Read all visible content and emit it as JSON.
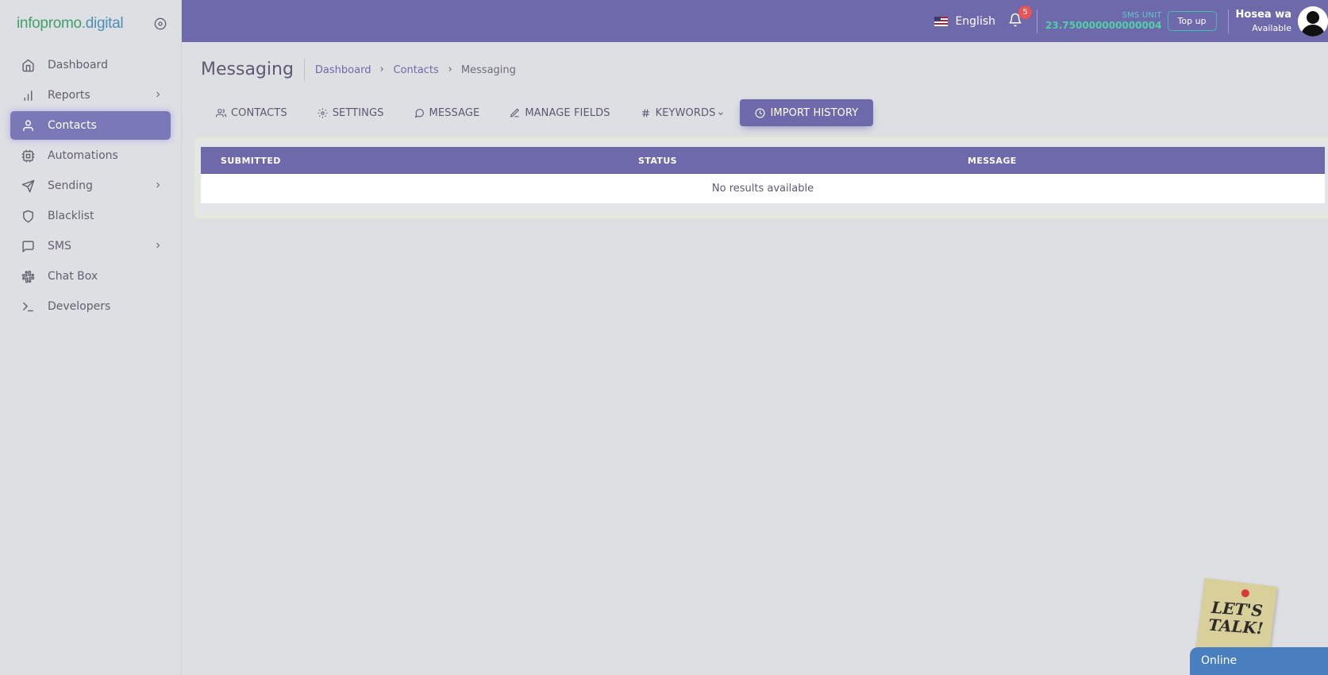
{
  "brand": {
    "logo_part1": "infopromo",
    "logo_part2": ".digital"
  },
  "sidebar": {
    "items": [
      {
        "label": "Dashboard",
        "icon": "home-icon",
        "has_chevron": false
      },
      {
        "label": "Reports",
        "icon": "bar-chart-icon",
        "has_chevron": true
      },
      {
        "label": "Contacts",
        "icon": "user-icon",
        "has_chevron": false,
        "active": true
      },
      {
        "label": "Automations",
        "icon": "cpu-icon",
        "has_chevron": false
      },
      {
        "label": "Sending",
        "icon": "send-icon",
        "has_chevron": true
      },
      {
        "label": "Blacklist",
        "icon": "shield-icon",
        "has_chevron": false
      },
      {
        "label": "SMS",
        "icon": "message-square-icon",
        "has_chevron": true
      },
      {
        "label": "Chat Box",
        "icon": "slack-icon",
        "has_chevron": false
      },
      {
        "label": "Developers",
        "icon": "terminal-icon",
        "has_chevron": false
      }
    ]
  },
  "topbar": {
    "language": "English",
    "notification_count": "5",
    "sms_unit_label": "SMS UNIT",
    "sms_unit_value": "23.750000000000004",
    "topup_label": "Top up",
    "user_name": "Hosea wa",
    "user_status": "Available"
  },
  "page": {
    "title": "Messaging",
    "breadcrumb": [
      "Dashboard",
      "Contacts",
      "Messaging"
    ]
  },
  "tabs": [
    {
      "label": "CONTACTS",
      "icon": "users-icon"
    },
    {
      "label": "SETTINGS",
      "icon": "settings-icon"
    },
    {
      "label": "MESSAGE",
      "icon": "message-circle-icon"
    },
    {
      "label": "MANAGE FIELDS",
      "icon": "edit-icon"
    },
    {
      "label": "KEYWORDS",
      "icon": "hash-icon",
      "dropdown": true
    },
    {
      "label": "IMPORT HISTORY",
      "icon": "clock-icon",
      "active": true
    }
  ],
  "table": {
    "columns": [
      "SUBMITTED",
      "STATUS",
      "MESSAGE"
    ],
    "empty_message": "No results available"
  },
  "chat_widget": {
    "note_text": "LET'S\nTALK!",
    "status": "Online"
  },
  "colors": {
    "primary": "#6d69ab",
    "active_nav": "#7b78b8",
    "credit": "#4fd1a5",
    "badge": "#ea5455"
  }
}
